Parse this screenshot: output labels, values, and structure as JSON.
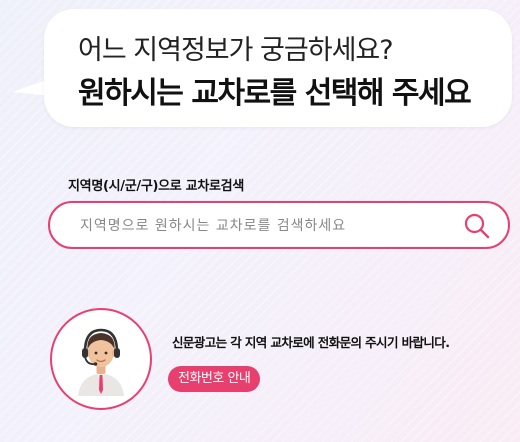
{
  "bubble": {
    "line1": "어느 지역정보가 궁금하세요?",
    "line2": "원하시는 교차로를 선택해 주세요"
  },
  "search": {
    "label": "지역명(시/군/구)으로 교차로검색",
    "placeholder": "지역명으로 원하시는 교차로를 검색하세요",
    "value": "",
    "icon": "search-icon"
  },
  "contact": {
    "message": "신문광고는 각 지역 교차로에 전화문의 주시기 바랍니다.",
    "button_label": "전화번호 안내",
    "avatar_icon": "operator-avatar-icon"
  },
  "colors": {
    "accent": "#e8406e",
    "text": "#111111",
    "bubble_bg": "#ffffff"
  }
}
